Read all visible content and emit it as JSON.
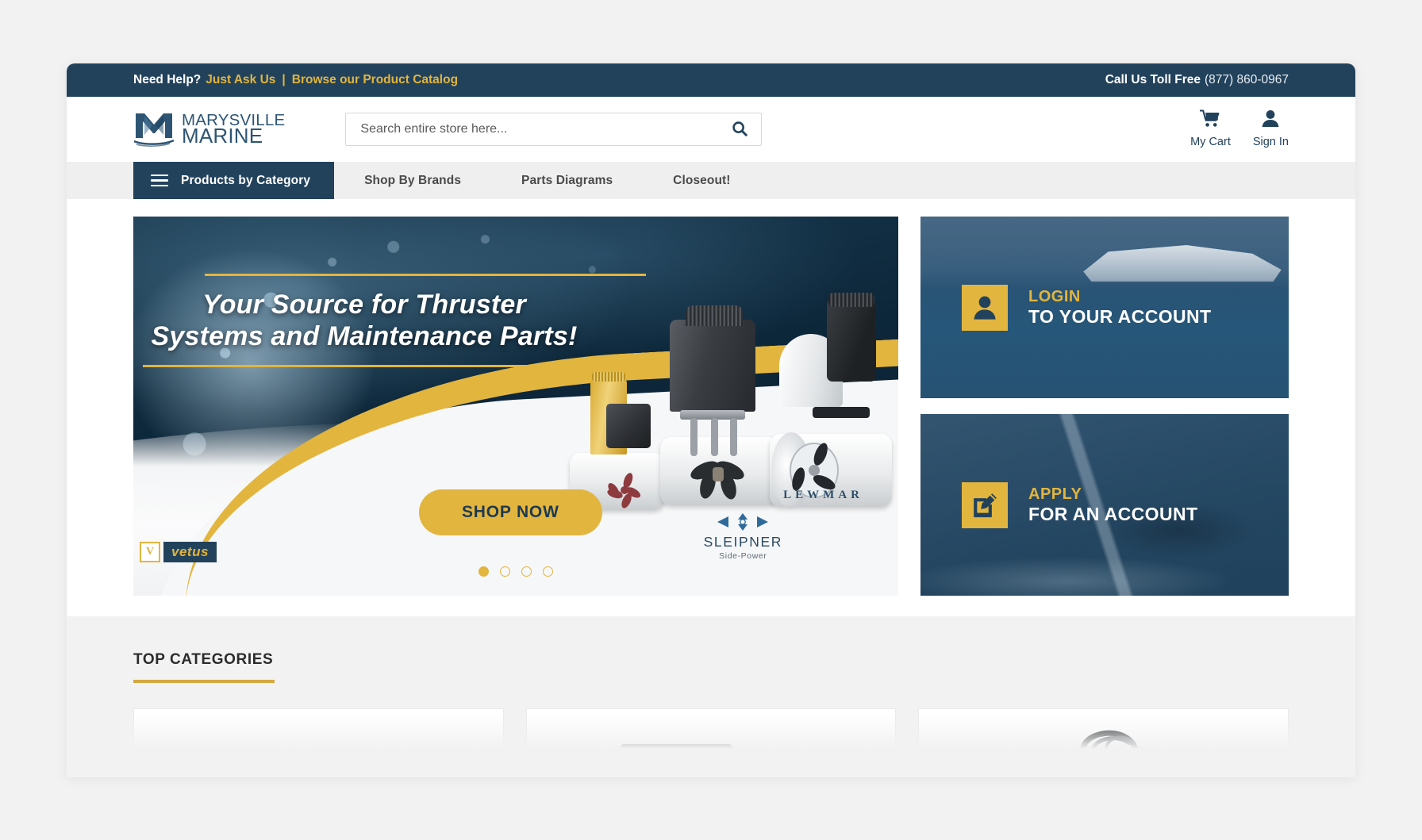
{
  "topbar": {
    "need_help": "Need Help?",
    "just_ask_us": "Just Ask Us",
    "separator": "|",
    "browse_catalog": "Browse our Product Catalog",
    "call_label": "Call Us Toll Free",
    "phone": "(877) 860-0967"
  },
  "header": {
    "logo_line1": "MARYSVILLE",
    "logo_line2": "MARINE",
    "search_placeholder": "Search entire store here...",
    "search_value": "",
    "search_icon": "search-icon",
    "cart_label": "My Cart",
    "cart_icon": "shopping-cart-icon",
    "signin_label": "Sign In",
    "signin_icon": "user-account-icon"
  },
  "nav": {
    "menu_icon": "hamburger-menu-icon",
    "primary_label": "Products by Category",
    "items": [
      {
        "label": "Shop By Brands"
      },
      {
        "label": "Parts Diagrams"
      },
      {
        "label": "Closeout!"
      }
    ]
  },
  "hero": {
    "title_line1": "Your Source for Thruster",
    "title_line2": "Systems and Maintenance Parts!",
    "cta_label": "SHOP NOW",
    "slides_total": 4,
    "active_slide": 1,
    "brands": [
      {
        "name": "LEWMAR"
      },
      {
        "name": "SLEIPNER",
        "tagline": "Side-Power"
      },
      {
        "name": "vetus",
        "mark": "V"
      }
    ]
  },
  "promos": [
    {
      "icon": "user-account-icon",
      "line1": "LOGIN",
      "line2": "TO YOUR ACCOUNT"
    },
    {
      "icon": "edit-square-icon",
      "line1": "APPLY",
      "line2": "FOR AN ACCOUNT"
    }
  ],
  "top_categories": {
    "heading": "TOP CATEGORIES",
    "cards": [
      {
        "image": "marine-tube-product-image"
      },
      {
        "image": "black-control-box-product-image"
      },
      {
        "image": "white-pump-with-wiring-product-image"
      }
    ]
  },
  "colors": {
    "navy": "#22425c",
    "gold": "#e2b53f",
    "nav_gray": "#efefef",
    "page_bg": "#f2f2f2",
    "text_dark": "#2b2b2b"
  }
}
